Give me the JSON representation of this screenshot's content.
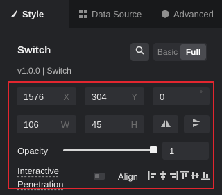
{
  "tabs": [
    {
      "label": "Style",
      "icon": "brush-icon",
      "active": true
    },
    {
      "label": "Data Source",
      "icon": "grid-icon",
      "active": false
    },
    {
      "label": "Advanced",
      "icon": "hexagon-icon",
      "active": false
    }
  ],
  "component": {
    "title": "Switch",
    "version": "v1.0.0 | Switch"
  },
  "mode_toggle": {
    "options": [
      "Basic",
      "Full"
    ],
    "selected": "Full"
  },
  "position": {
    "x": {
      "value": "1576",
      "unit": "X"
    },
    "y": {
      "value": "304",
      "unit": "Y"
    },
    "rotation": {
      "value": "0",
      "unit": "°"
    }
  },
  "size": {
    "width": {
      "value": "106",
      "unit": "W"
    },
    "height": {
      "value": "45",
      "unit": "H"
    }
  },
  "opacity": {
    "label": "Opacity",
    "value": "1",
    "level": 1.0
  },
  "interactive": {
    "label_line1": "Interactive",
    "label_line2": "Penetration",
    "enabled": false
  },
  "align": {
    "label": "Align",
    "icons": [
      "align-left-icon",
      "align-center-h-icon",
      "align-right-icon",
      "align-top-icon",
      "align-center-v-icon",
      "align-bottom-icon"
    ]
  },
  "colors": {
    "highlight_border": "#e3262f",
    "background": "#232427"
  }
}
